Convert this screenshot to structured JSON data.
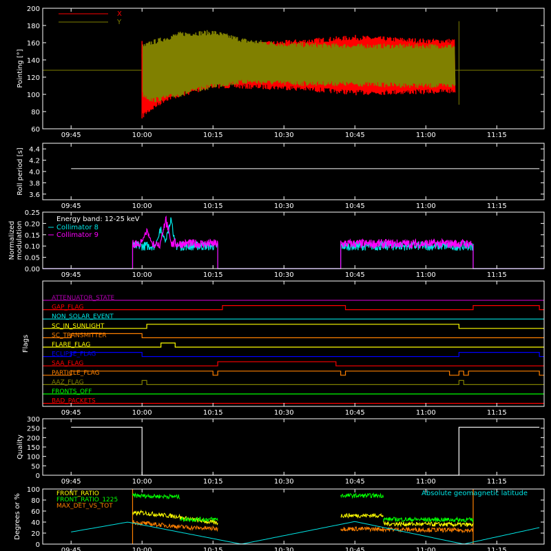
{
  "time_ticks": [
    "09:45",
    "10:00",
    "10:15",
    "10:30",
    "10:45",
    "11:00",
    "11:15"
  ],
  "colors": {
    "background": "#000000",
    "axis": "#ffffff",
    "red": "#ff0000",
    "olive": "#808000",
    "white": "#ffffff",
    "cyan": "#00e5e5",
    "magenta": "#ff00ff",
    "orange": "#ff8000",
    "yellow": "#ffff00",
    "green": "#00ff00",
    "blue": "#0000ff",
    "purple": "#b000b0"
  },
  "chart_data": [
    {
      "type": "line",
      "panel": "pointing",
      "ylabel": "Pointing [°]",
      "ylim": [
        60,
        200
      ],
      "yticks": [
        60,
        80,
        100,
        120,
        140,
        160,
        180,
        200
      ],
      "legend_placement": "top-left",
      "series": [
        {
          "name": "X",
          "color": "#ff0000",
          "kind": "band",
          "x": [
            "10:00",
            "10:01",
            "10:05",
            "10:15",
            "10:30",
            "10:45",
            "11:00",
            "11:06"
          ],
          "lo": [
            75,
            80,
            95,
            110,
            108,
            102,
            103,
            104
          ],
          "hi": [
            150,
            145,
            150,
            155,
            160,
            166,
            162,
            162
          ]
        },
        {
          "name": "Y",
          "color": "#808000",
          "kind": "band",
          "x": [
            "10:00",
            "10:02",
            "10:08",
            "10:15",
            "10:22",
            "10:30",
            "10:45",
            "11:00",
            "11:06"
          ],
          "lo": [
            100,
            93,
            100,
            110,
            115,
            113,
            112,
            110,
            110
          ],
          "hi": [
            155,
            160,
            170,
            172,
            162,
            158,
            156,
            156,
            156
          ]
        },
        {
          "name": "Y reference",
          "color": "#808000",
          "kind": "hline",
          "y": 128
        }
      ]
    },
    {
      "type": "line",
      "panel": "roll_period",
      "ylabel": "Roll period [s]",
      "ylim": [
        3.5,
        4.5
      ],
      "yticks": [
        3.6,
        3.8,
        4.0,
        4.2,
        4.4
      ],
      "series": [
        {
          "color": "#ffffff",
          "x": [
            "09:45",
            "11:24"
          ],
          "y": [
            4.05,
            4.05
          ]
        }
      ]
    },
    {
      "type": "line",
      "panel": "modulation",
      "ylabel_lines": [
        "Normalized",
        "modulation"
      ],
      "ylim": [
        0,
        0.25
      ],
      "yticks": [
        0.0,
        0.05,
        0.1,
        0.15,
        0.2,
        0.25
      ],
      "annotation": "Energy band: 12-25 keV",
      "series": [
        {
          "name": "Collimator 8",
          "color": "#00e5e5",
          "segments": [
            {
              "x": [
                "09:58",
                "10:16"
              ],
              "x_steps": [
                [
                  "09:58",
                  "09:59",
                  "10:00"
                ],
                [
                  "10:00",
                  "10:16"
                ]
              ]
            },
            {
              "x": [
                "10:42",
                "11:10"
              ]
            }
          ],
          "level": 0.1,
          "noise": 0.02,
          "peaks": [
            {
              "x": "10:04",
              "y": 0.2
            },
            {
              "x": "10:06",
              "y": 0.25
            }
          ]
        },
        {
          "name": "Collimator 9",
          "color": "#ff00ff",
          "segments": [
            {
              "x": [
                "09:58",
                "10:16"
              ]
            },
            {
              "x": [
                "10:42",
                "11:10"
              ]
            }
          ],
          "level": 0.11,
          "noise": 0.02,
          "peaks": [
            {
              "x": "10:01",
              "y": 0.18
            },
            {
              "x": "10:05",
              "y": 0.25
            }
          ]
        }
      ]
    },
    {
      "type": "timeline",
      "panel": "flags",
      "ylabel": "Flags",
      "flags": [
        {
          "name": "ATTENUATOR_STATE",
          "color": "#b000b0",
          "high": []
        },
        {
          "name": "GAP_FLAG",
          "color": "#ff0000",
          "high": [
            [
              "10:17",
              "10:43"
            ],
            [
              "11:10",
              "11:24"
            ]
          ]
        },
        {
          "name": "NON_SOLAR_EVENT",
          "color": "#00e5e5",
          "high": []
        },
        {
          "name": "SC_IN_SUNLIGHT",
          "color": "#ffff00",
          "high": [
            [
              "10:01",
              "11:07"
            ]
          ]
        },
        {
          "name": "SC_TRANSMITTER",
          "color": "#ff8000",
          "high": [
            [
              "09:45",
              "10:00"
            ]
          ]
        },
        {
          "name": "FLARE_FLAG",
          "color": "#ffff00",
          "high": [
            [
              "10:04",
              "10:07"
            ]
          ]
        },
        {
          "name": "ECLIPSE_FLAG",
          "color": "#0000ff",
          "high": [
            [
              "09:45",
              "10:00"
            ],
            [
              "11:07",
              "11:24"
            ]
          ]
        },
        {
          "name": "SAA_FLAG",
          "color": "#ff0000",
          "high": [
            [
              "10:16",
              "10:41"
            ]
          ]
        },
        {
          "name": "PARTICLE_FLAG",
          "color": "#ff8000",
          "high": [
            [
              "09:45",
              "10:15"
            ],
            [
              "10:16",
              "10:42"
            ],
            [
              "10:43",
              "11:05"
            ],
            [
              "11:07",
              "11:08"
            ],
            [
              "11:09",
              "11:24"
            ]
          ]
        },
        {
          "name": "AAZ_FLAG",
          "color": "#808000",
          "high": [
            [
              "10:00",
              "10:01"
            ],
            [
              "11:07",
              "11:08"
            ]
          ]
        },
        {
          "name": "FRONTS_OFF",
          "color": "#00ff00",
          "high": []
        },
        {
          "name": "BAD_PACKETS",
          "color": "#ff0000",
          "high": []
        }
      ]
    },
    {
      "type": "line",
      "panel": "quality",
      "ylabel": "Quality",
      "ylim": [
        0,
        300
      ],
      "yticks": [
        0,
        50,
        100,
        150,
        200,
        250,
        300
      ],
      "series": [
        {
          "color": "#ffffff",
          "x": [
            "09:45",
            "10:00",
            "10:00",
            "11:07",
            "11:07",
            "11:24"
          ],
          "y": [
            255,
            255,
            0,
            0,
            255,
            255
          ]
        }
      ]
    },
    {
      "type": "line",
      "panel": "ratios",
      "ylabel": "Degrees or %",
      "ylim": [
        0,
        100
      ],
      "yticks": [
        0,
        20,
        40,
        60,
        80,
        100
      ],
      "legend_placement": "top-left",
      "series": [
        {
          "name": "FRONT_RATIO",
          "color": "#ffff00",
          "segments": [
            {
              "x": [
                "09:58",
                "10:00",
                "10:02",
                "10:05",
                "10:08"
              ],
              "y": [
                55,
                57,
                55,
                52,
                50
              ]
            },
            {
              "x": [
                "10:08",
                "10:16"
              ],
              "y": [
                48,
                38
              ]
            },
            {
              "x": [
                "10:42",
                "10:51"
              ],
              "y": [
                52,
                52
              ]
            },
            {
              "x": [
                "10:51",
                "11:10"
              ],
              "y": [
                37,
                35
              ]
            }
          ]
        },
        {
          "name": "FRONT_RATIO_1225",
          "color": "#00ff00",
          "segments": [
            {
              "x": [
                "09:58",
                "10:08"
              ],
              "y": [
                88,
                86
              ]
            },
            {
              "x": [
                "10:08",
                "10:16"
              ],
              "y": [
                45,
                45
              ]
            },
            {
              "x": [
                "10:42",
                "10:51"
              ],
              "y": [
                88,
                88
              ]
            },
            {
              "x": [
                "10:51",
                "11:10"
              ],
              "y": [
                45,
                44
              ]
            }
          ]
        },
        {
          "name": "MAX_DET_VS_TOT",
          "color": "#ff8000",
          "segments": [
            {
              "x": [
                "09:58",
                "10:00",
                "10:10",
                "10:16"
              ],
              "y": [
                40,
                38,
                30,
                28
              ]
            },
            {
              "x": [
                "10:42",
                "11:10"
              ],
              "y": [
                28,
                25
              ]
            }
          ]
        },
        {
          "name": "Absolute geomagnetic latitude",
          "color": "#00e5e5",
          "x": [
            "09:45",
            "09:57",
            "10:21",
            "10:45",
            "11:08",
            "11:24"
          ],
          "y": [
            22,
            40,
            0,
            41,
            0,
            30
          ]
        }
      ],
      "step_markers": {
        "color": "#ff8000",
        "x": [
          "09:58",
          "11:10"
        ],
        "y": [
          0,
          100
        ]
      }
    }
  ]
}
